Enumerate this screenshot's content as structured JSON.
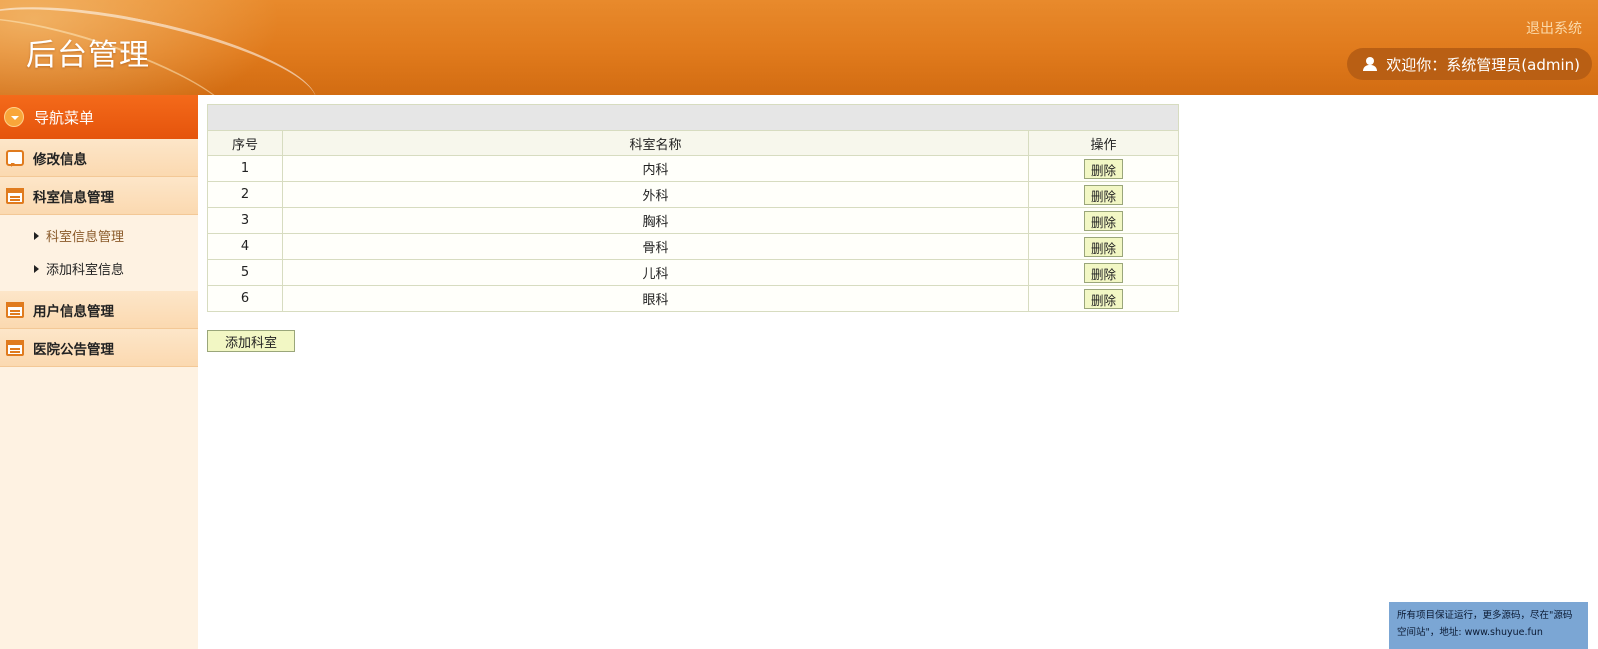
{
  "header": {
    "title": "后台管理",
    "logout_label": "退出系统",
    "welcome_text": "欢迎你：系统管理员(admin)"
  },
  "sidebar": {
    "nav_title": "导航菜单",
    "items": [
      {
        "label": "修改信息",
        "icon": "chat-icon"
      },
      {
        "label": "科室信息管理",
        "icon": "calendar-icon",
        "children": [
          {
            "label": "科室信息管理",
            "active": true
          },
          {
            "label": "添加科室信息",
            "active": false
          }
        ]
      },
      {
        "label": "用户信息管理",
        "icon": "calendar-icon"
      },
      {
        "label": "医院公告管理",
        "icon": "calendar-icon"
      }
    ]
  },
  "table": {
    "columns": [
      "序号",
      "科室名称",
      "操作"
    ],
    "rows": [
      {
        "idx": "1",
        "name": "内科",
        "action": "删除"
      },
      {
        "idx": "2",
        "name": "外科",
        "action": "删除"
      },
      {
        "idx": "3",
        "name": "胸科",
        "action": "删除"
      },
      {
        "idx": "4",
        "name": "骨科",
        "action": "删除"
      },
      {
        "idx": "5",
        "name": "儿科",
        "action": "删除"
      },
      {
        "idx": "6",
        "name": "眼科",
        "action": "删除"
      }
    ]
  },
  "add_button_label": "添加科室",
  "notice": {
    "line1": "所有项目保证运行，更多源码，尽在\"源码",
    "line2": "空间站\"，地址: www.shuyue.fun"
  },
  "colors": {
    "header_orange": "#e07a1c",
    "nav_head": "#f46a1a",
    "sidebar_bg": "#fef2e2",
    "button_bg": "#f2f7c4",
    "notice_bg": "#7ba6d4"
  }
}
